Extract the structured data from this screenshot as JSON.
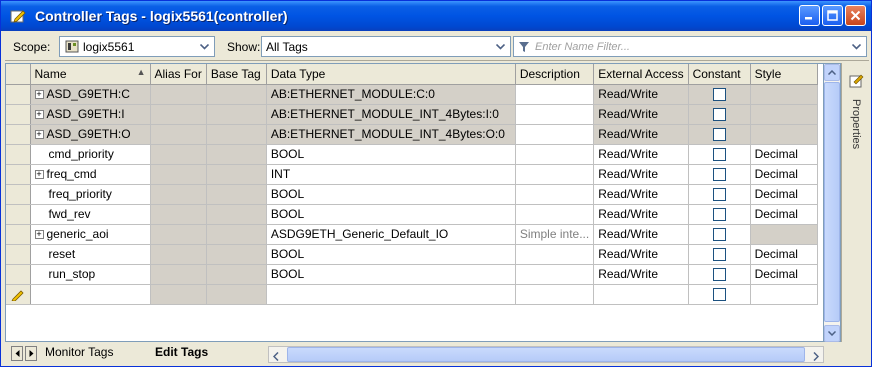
{
  "window": {
    "title": "Controller Tags - logix5561(controller)"
  },
  "toolbar": {
    "scope_label": "Scope:",
    "scope_value": "logix5561",
    "show_label": "Show:",
    "show_value": "All Tags",
    "filter_placeholder": "Enter Name Filter..."
  },
  "grid": {
    "columns": [
      "Name",
      "Alias For",
      "Base Tag",
      "Data Type",
      "Description",
      "External Access",
      "Constant",
      "Style"
    ],
    "rows": [
      {
        "name": "ASD_G9ETH:C",
        "expandable": true,
        "alias_for": "",
        "base_tag": "",
        "data_type": "AB:ETHERNET_MODULE:C:0",
        "description": "",
        "external_access": "Read/Write",
        "constant": false,
        "style": ""
      },
      {
        "name": "ASD_G9ETH:I",
        "expandable": true,
        "alias_for": "",
        "base_tag": "",
        "data_type": "AB:ETHERNET_MODULE_INT_4Bytes:I:0",
        "description": "",
        "external_access": "Read/Write",
        "constant": false,
        "style": ""
      },
      {
        "name": "ASD_G9ETH:O",
        "expandable": true,
        "alias_for": "",
        "base_tag": "",
        "data_type": "AB:ETHERNET_MODULE_INT_4Bytes:O:0",
        "description": "",
        "external_access": "Read/Write",
        "constant": false,
        "style": ""
      },
      {
        "name": "cmd_priority",
        "expandable": false,
        "alias_for": "",
        "base_tag": "",
        "data_type": "BOOL",
        "description": "",
        "external_access": "Read/Write",
        "constant": false,
        "style": "Decimal"
      },
      {
        "name": "freq_cmd",
        "expandable": true,
        "alias_for": "",
        "base_tag": "",
        "data_type": "INT",
        "description": "",
        "external_access": "Read/Write",
        "constant": false,
        "style": "Decimal"
      },
      {
        "name": "freq_priority",
        "expandable": false,
        "alias_for": "",
        "base_tag": "",
        "data_type": "BOOL",
        "description": "",
        "external_access": "Read/Write",
        "constant": false,
        "style": "Decimal"
      },
      {
        "name": "fwd_rev",
        "expandable": false,
        "alias_for": "",
        "base_tag": "",
        "data_type": "BOOL",
        "description": "",
        "external_access": "Read/Write",
        "constant": false,
        "style": "Decimal"
      },
      {
        "name": "generic_aoi",
        "expandable": true,
        "alias_for": "",
        "base_tag": "",
        "data_type": "ASDG9ETH_Generic_Default_IO",
        "description": "Simple inte...",
        "external_access": "Read/Write",
        "constant": false,
        "style": ""
      },
      {
        "name": "reset",
        "expandable": false,
        "alias_for": "",
        "base_tag": "",
        "data_type": "BOOL",
        "description": "",
        "external_access": "Read/Write",
        "constant": false,
        "style": "Decimal"
      },
      {
        "name": "run_stop",
        "expandable": false,
        "alias_for": "",
        "base_tag": "",
        "data_type": "BOOL",
        "description": "",
        "external_access": "Read/Write",
        "constant": false,
        "style": "Decimal"
      }
    ]
  },
  "side_panel": {
    "label": "Properties"
  },
  "tabs": {
    "monitor": "Monitor Tags",
    "edit": "Edit Tags"
  },
  "icons": {
    "title": "pencil-icon",
    "scope": "controller-icon",
    "filter": "filter-icon"
  },
  "colors": {
    "titlebar": "#0054e3",
    "grid_line": "#c0c0c0",
    "gray_cell": "#d4d0c8"
  }
}
